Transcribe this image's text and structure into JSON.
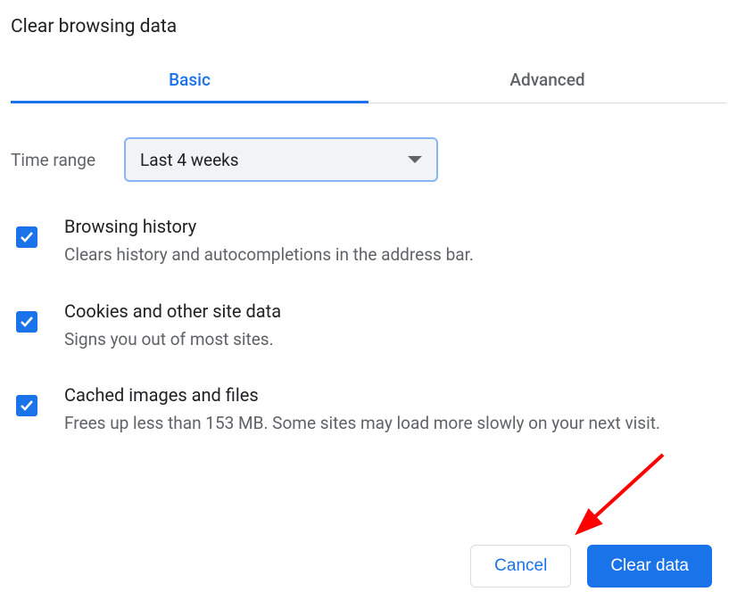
{
  "title": "Clear browsing data",
  "tabs": {
    "basic": "Basic",
    "advanced": "Advanced"
  },
  "timerange": {
    "label": "Time range",
    "value": "Last 4 weeks"
  },
  "options": [
    {
      "title": "Browsing history",
      "desc": "Clears history and autocompletions in the address bar."
    },
    {
      "title": "Cookies and other site data",
      "desc": "Signs you out of most sites."
    },
    {
      "title": "Cached images and files",
      "desc": "Frees up less than 153 MB. Some sites may load more slowly on your next visit."
    }
  ],
  "buttons": {
    "cancel": "Cancel",
    "clear": "Clear data"
  }
}
